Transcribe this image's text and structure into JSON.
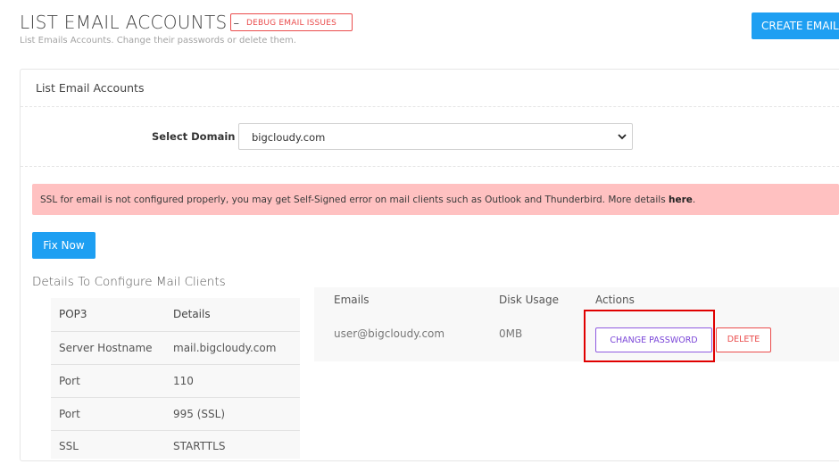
{
  "header": {
    "title": "LIST EMAIL ACCOUNTS -",
    "debug_label": "DEBUG EMAIL ISSUES",
    "subtitle": "List Emails Accounts. Change their passwords or delete them.",
    "create_label": "CREATE EMAIL"
  },
  "panel": {
    "title": "List Email Accounts",
    "select_label": "Select Domain",
    "selected_domain": "bigcloudy.com"
  },
  "alert": {
    "text": "SSL for email is not configured properly, you may get Self-Signed error on mail clients such as Outlook and Thunderbird. More details ",
    "link_text": "here",
    "suffix": "."
  },
  "fix_label": "Fix Now",
  "mail_clients": {
    "heading": "Details To Configure Mail Clients",
    "columns": [
      "POP3",
      "Details"
    ],
    "rows": [
      {
        "label": "Server Hostname",
        "value": "mail.bigcloudy.com"
      },
      {
        "label": "Port",
        "value": "110"
      },
      {
        "label": "Port",
        "value": "995 (SSL)"
      },
      {
        "label": "SSL",
        "value": "STARTTLS"
      }
    ]
  },
  "emails_table": {
    "columns": [
      "Emails",
      "Disk Usage",
      "Actions"
    ],
    "rows": [
      {
        "email": "user@bigcloudy.com",
        "usage": "0MB",
        "change_label": "CHANGE PASSWORD",
        "delete_label": "DELETE"
      }
    ]
  },
  "colors": {
    "primary": "#1e9ff2",
    "danger": "#ea4c4c",
    "purple": "#8f5be0",
    "alert_bg": "#ffc1c1",
    "highlight": "#e00000"
  }
}
